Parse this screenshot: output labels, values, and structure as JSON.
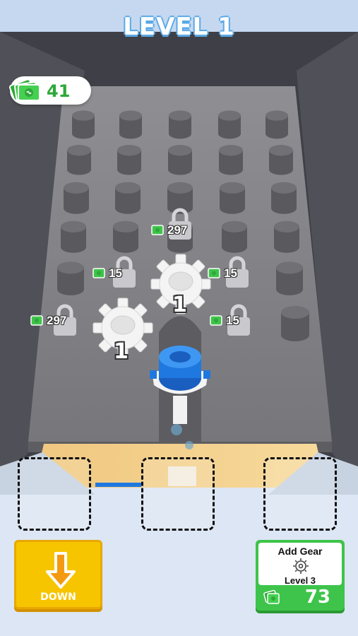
{
  "level_title": "LEVEL 1",
  "currency": {
    "amount": "41",
    "icon": "cash-icon"
  },
  "locks": [
    {
      "price": "297"
    },
    {
      "price": "15"
    },
    {
      "price": "15"
    },
    {
      "price": "297"
    },
    {
      "price": "15"
    }
  ],
  "gears": [
    {
      "level": "1"
    },
    {
      "level": "1"
    }
  ],
  "down_button": {
    "label": "DOWN",
    "icon": "down-arrow-icon"
  },
  "add_gear": {
    "title": "Add Gear",
    "level": "Level 3",
    "price": "73",
    "icon": "gear-icon"
  },
  "colors": {
    "accent_blue": "#1f78e0",
    "cash_green": "#3ec44a",
    "button_yellow": "#f7c500"
  }
}
